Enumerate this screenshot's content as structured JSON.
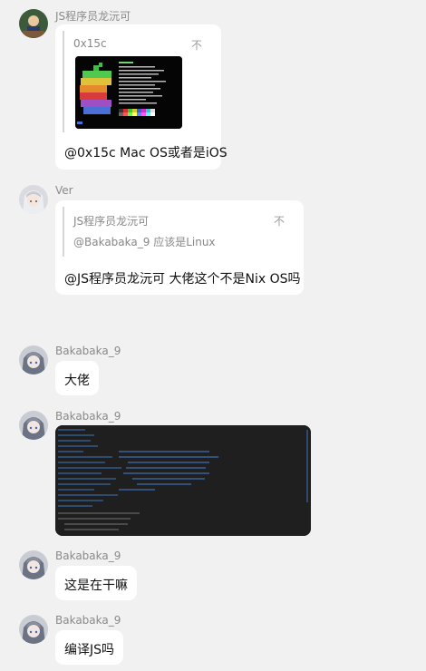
{
  "messages": {
    "m1": {
      "sender": "JS程序员龙沅可",
      "quote": {
        "author": "0x15c",
        "close_icon": "不"
      },
      "text": "@0x15c Mac OS或者是iOS"
    },
    "m2": {
      "sender": "Ver",
      "quote": {
        "author": "JS程序员龙沅可",
        "text": "@Bakabaka_9 应该是Linux",
        "close_icon": "不"
      },
      "text": "@JS程序员龙沅可 大佬这个不是Nix OS吗"
    },
    "m3": {
      "sender": "Bakabaka_9",
      "text": "大佬"
    },
    "m4": {
      "sender": "Bakabaka_9"
    },
    "m5": {
      "sender": "Bakabaka_9",
      "text": "这是在干嘛"
    },
    "m6": {
      "sender": "Bakabaka_9",
      "text": "编译JS吗"
    }
  },
  "colors": {
    "background": "#f1f1f1",
    "bubble": "#ffffff",
    "meta_text": "#8a8a8a",
    "terminal_bg": "#050505",
    "screenshot_bg": "#1f1f20"
  }
}
